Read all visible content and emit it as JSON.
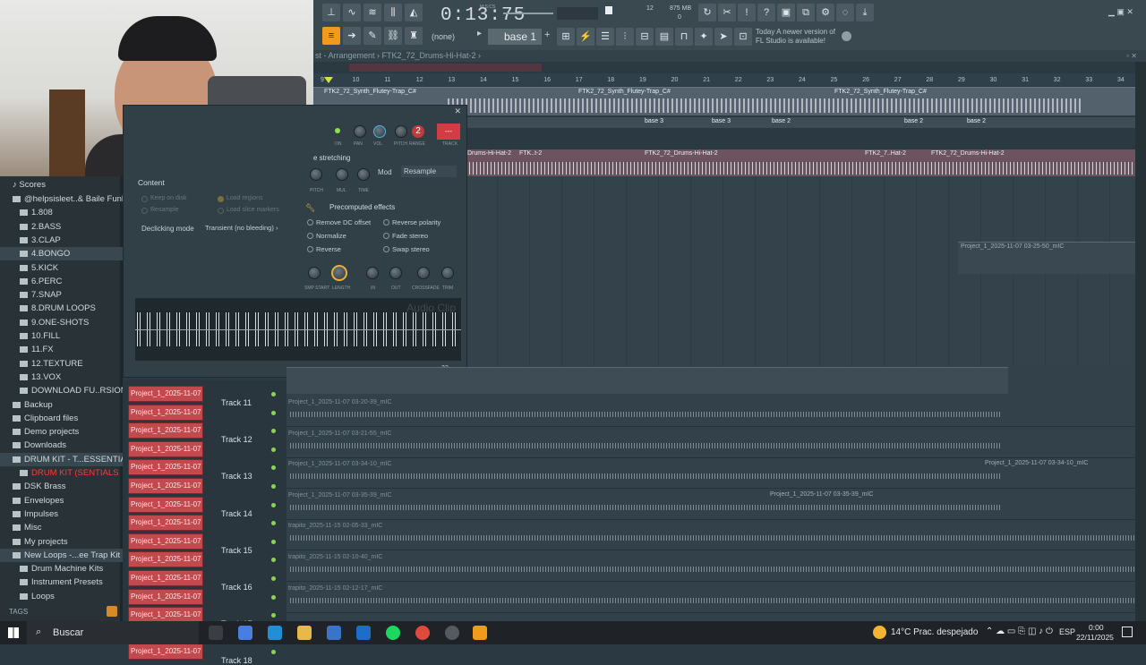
{
  "toolbar": {
    "time": "0:13:75",
    "time_unit": "M:S:CS",
    "cpu_number": "12",
    "memory": "875 MB",
    "poly": "0",
    "none_label": "(none)",
    "pattern": "base 1",
    "news_line1": "Today  A newer version of",
    "news_line2": "FL Studio is available!"
  },
  "window": {
    "breadcrumb": "st - Arrangement  ›  FTK2_72_Drums-Hi-Hat-2  ›"
  },
  "ruler": {
    "ticks": [
      "9",
      "10",
      "11",
      "12",
      "13",
      "14",
      "15",
      "16",
      "17",
      "18",
      "19",
      "20",
      "21",
      "22",
      "23",
      "24",
      "25",
      "26",
      "27",
      "28",
      "29",
      "30",
      "31",
      "32",
      "33",
      "34"
    ]
  },
  "clips": {
    "synth_left": "FTK2_72_Synth_Flutey-Trap_C#",
    "synth_mid": "FTK2_72_Synth_Flutey-Trap_C#",
    "synth_right": "FTK2_72_Synth_Flutey-Trap_C#",
    "base_labels": [
      "base 3",
      "base 3",
      "base 2",
      "base 2",
      "base 2"
    ],
    "drums_left": "Drums-Hi-Hat-2",
    "drums_mid": "FTK2_72_Drums-Hi-Hat-2",
    "drums_right": "FTK2_72_Drums-Hi-Hat-2",
    "ftk_short": "FTK..t-2",
    "ftk_hat": "FTK2_7..Hat-2",
    "proj_top": "Project_1_2025-11-07 03-25-50_mIC"
  },
  "browser": {
    "header": "Scores",
    "items": [
      "@helpsisleet..& Baile Funk)",
      "1.808",
      "2.BASS",
      "3.CLAP",
      "4.BONGO",
      "5.KICK",
      "6.PERC",
      "7.SNAP",
      "8.DRUM LOOPS",
      "9.ONE-SHOTS",
      "10.FILL",
      "11.FX",
      "12.TEXTURE",
      "13.VOX",
      "DOWNLOAD FU..RSION HERE",
      "Backup",
      "Clipboard files",
      "Demo projects",
      "Downloads",
      "DRUM KIT - T...ESSENTIALS",
      "DRUM KIT (SENTIALS",
      "DSK Brass",
      "Envelopes",
      "Impulses",
      "Misc",
      "My projects",
      "New Loops -...ee Trap Kit 2",
      "Drum Machine Kits",
      "Instrument Presets",
      "Loops"
    ],
    "tags_label": "TAGS"
  },
  "channel": {
    "knob_labels": [
      "ON",
      "PAN",
      "VOL",
      "PITCH",
      "RANGE",
      "TRACK"
    ],
    "range_value": "2",
    "track_value": "---",
    "stretch_title": "e stretching",
    "stretch_knobs": [
      "PITCH",
      "MUL",
      "TIME"
    ],
    "mode_label": "Mod",
    "mode_value": "Resample",
    "content_title": "Content",
    "keep_on_disk": "Keep on disk",
    "load_regions": "Load regions",
    "resample": "Resample",
    "load_slice_markers": "Load slice markers",
    "declicking_label": "Declicking mode",
    "declicking_value": "Transient (no bleeding)",
    "precomputed_title": "Precomputed effects",
    "effects": [
      "Remove DC offset",
      "Reverse polarity",
      "Normalize",
      "Fade stereo",
      "Reverse",
      "Swap stereo"
    ],
    "bottom_knobs": [
      "SMP START",
      "LENGTH",
      "IN",
      "OUT",
      "CROSSFADE",
      "TRIM"
    ],
    "watermark": "Audio Clip",
    "zoom": "32"
  },
  "tracks": [
    {
      "clip": "Project_1_2025-11-07 0...",
      "name": "Track 11"
    },
    {
      "clip": "Project_1_2025-11-07 0...",
      "name": ""
    },
    {
      "clip": "Project_1_2025-11-07 0...",
      "name": "Track 12"
    },
    {
      "clip": "Project_1_2025-11-07 0...",
      "name": ""
    },
    {
      "clip": "Project_1_2025-11-07 0...",
      "name": "Track 13"
    },
    {
      "clip": "Project_1_2025-11-07 0...",
      "name": ""
    },
    {
      "clip": "Project_1_2025-11-07 0...",
      "name": "Track 14"
    },
    {
      "clip": "Project_1_2025-11-07 0...",
      "name": ""
    },
    {
      "clip": "Project_1_2025-11-07 0...",
      "name": "Track 15"
    },
    {
      "clip": "Project_1_2025-11-07 0...",
      "name": ""
    },
    {
      "clip": "Project_1_2025-11-07 0...",
      "name": "Track 16"
    },
    {
      "clip": "Project_1_2025-11-07 0...",
      "name": ""
    },
    {
      "clip": "Project_1_2025-11-07 0...",
      "name": "Track 17"
    },
    {
      "clip": "Project_1_2025-11-07 0...",
      "name": ""
    },
    {
      "clip": "Project_1_2025-11-07 0...",
      "name": "Track 18"
    }
  ],
  "lanes": [
    "Project_1_2025-11-07 03-20-39_mIC",
    "Project_1_2025-11-07 03-21-55_mIC",
    "Project_1_2025-11-07 03-34-10_mIC",
    "Project_1_2025-11-07 03-35-39_mIC",
    "trapito_2025-11-15 02-05-33_mIC",
    "trapito_2025-11-15 02-10-40_mIC",
    "trapito_2025-11-15 02-12-17_mIC"
  ],
  "lane_extra": {
    "lane3_right": "Project_1_2025-11-07 03-34-10_mIC",
    "lane4_mid": "Project_1_2025-11-07 03-35-39_mIC"
  },
  "taskbar": {
    "search": "Buscar",
    "weather": "14°C  Prac. despejado",
    "lang": "ESP",
    "time": "0:00",
    "date": "22/11/2025"
  }
}
